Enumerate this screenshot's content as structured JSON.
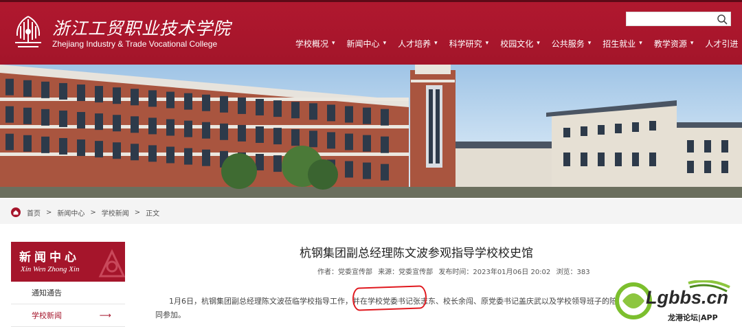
{
  "header": {
    "logo_cn": "浙江工贸职业技术学院",
    "logo_en": "Zhejiang Industry & Trade Vocational College",
    "search_placeholder": ""
  },
  "nav": [
    {
      "label": "学校概况",
      "caret": "▾"
    },
    {
      "label": "新闻中心",
      "caret": "▾"
    },
    {
      "label": "人才培养",
      "caret": "▾"
    },
    {
      "label": "科学研究",
      "caret": "▾"
    },
    {
      "label": "校园文化",
      "caret": "▾"
    },
    {
      "label": "公共服务",
      "caret": "▾"
    },
    {
      "label": "招生就业",
      "caret": "▾"
    },
    {
      "label": "教学资源",
      "caret": "▾"
    },
    {
      "label": "人才引进",
      "caret": ""
    }
  ],
  "breadcrumb": [
    "首页",
    ">",
    "新闻中心",
    ">",
    "学校新闻",
    ">",
    "正文"
  ],
  "sidebar": {
    "title_cn": "新闻中心",
    "title_pinyin": "Xin Wen Zhong Xin",
    "items": [
      {
        "label": "通知通告",
        "arrow": ""
      },
      {
        "label": "学校新闻",
        "arrow": "⟶"
      }
    ]
  },
  "article": {
    "title": "杭钢集团副总经理陈文波参观指导学校校史馆",
    "meta": {
      "author": "作者：党委宣传部",
      "source": "来源：党委宣传部",
      "time": "发布时间：2023年01月06日 20:02",
      "views": "浏览：383"
    },
    "body_line1": "1月6日，杭钢集团副总经理陈文波莅临学校指导工作，并在学校党委书记张志东、校长余闯、原党委书记盖庆武以及学校领导班子的陪同下参观",
    "body_line2": "同参加。"
  },
  "watermark": {
    "text": "Lgbbs.cn",
    "sub": "龙港论坛|APP"
  },
  "colors": {
    "brand": "#a5152b",
    "highlight_ring": "#e0181e"
  }
}
